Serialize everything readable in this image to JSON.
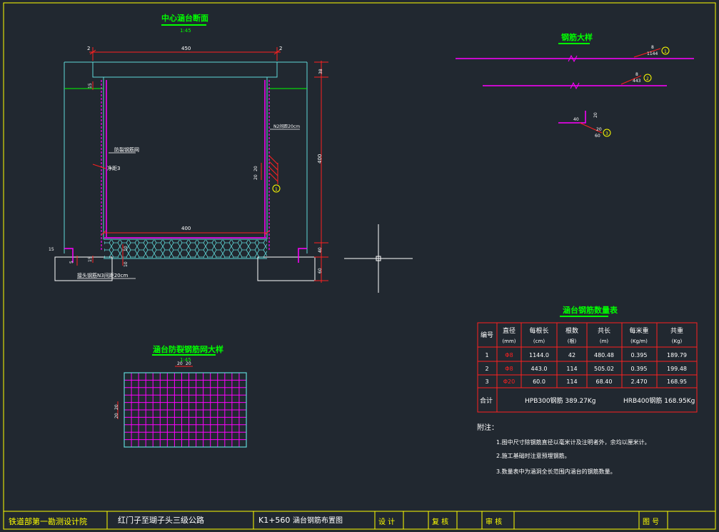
{
  "colors": {
    "background": "#212830",
    "frame": "#ffff00",
    "concrete": "#5fd7d7",
    "rebar_magenta": "#ff00ff",
    "rebar_red": "#ff2020",
    "title_green": "#00ff00",
    "dimension": "#ff2020",
    "text": "#ffffff"
  },
  "section": {
    "title": "中心涵台断面",
    "scale": "1:45",
    "dim_top_width": "450",
    "dim_left_offset": "2",
    "dim_right_offset": "2",
    "dim_top_slab": "38",
    "dim_height": "400",
    "dim_bottom_slab": "40",
    "dim_foundation": "60",
    "dim_inner_width": "400",
    "dim_15_top": "15",
    "dim_15_bottom": "15",
    "dim_10_a": "10",
    "dim_10_b": "10",
    "dim_20_a": "20",
    "dim_20_b": "20",
    "dim_20_c": "20",
    "dim_20_d": "20",
    "label_mesh": "防裂钢筋网",
    "label_gap": "净距3",
    "label_n2": "N2间距20cm",
    "label_n3": "接头钢筋N3间距20cm",
    "label_15": "15",
    "label_50": "5",
    "marker_1": "1",
    "marker_2": "2"
  },
  "detail": {
    "title": "钢筋大样",
    "bar1_len": "1144",
    "bar1_d": "8",
    "bar1_no": "1",
    "bar2_len": "443",
    "bar2_d": "8",
    "bar2_no": "2",
    "bar3_h": "40",
    "bar3_d": "20",
    "bar3_len": "60",
    "bar3_20": "20",
    "bar3_no": "3"
  },
  "mesh": {
    "title": "涵台防裂钢筋网大样",
    "scale": "1:45",
    "spacing_h1": "20",
    "spacing_h2": "20",
    "spacing_v1": "20",
    "spacing_v2": "20"
  },
  "table": {
    "title": "涵台钢筋数量表",
    "headers": [
      {
        "main": "编号",
        "unit": ""
      },
      {
        "main": "直径",
        "unit": "(mm)"
      },
      {
        "main": "每根长",
        "unit": "(cm)"
      },
      {
        "main": "根数",
        "unit": "(根)"
      },
      {
        "main": "共长",
        "unit": "(m)"
      },
      {
        "main": "每米重",
        "unit": "(Kg/m)"
      },
      {
        "main": "共重",
        "unit": "(Kg)"
      }
    ],
    "rows": [
      [
        "1",
        "Φ8",
        "1144.0",
        "42",
        "480.48",
        "0.395",
        "189.79"
      ],
      [
        "2",
        "Φ8",
        "443.0",
        "114",
        "505.02",
        "0.395",
        "199.48"
      ],
      [
        "3",
        "Φ20",
        "60.0",
        "114",
        "68.40",
        "2.470",
        "168.95"
      ]
    ],
    "total_label": "合计",
    "total_hpb": "HPB300钢筋  389.27Kg",
    "total_hrb": "HRB400钢筋  168.95Kg"
  },
  "notes": {
    "heading": "附注：",
    "items": [
      "1.图中尺寸除钢筋直径以毫米计及注明者外，余均以厘米计。",
      "2.施工基础时注意预埋钢筋。",
      "3.数量表中为涵洞全长范围内涵台的钢筋数量。"
    ]
  },
  "title_block": {
    "org": "铁道部第一勘测设计院",
    "project": "红门子至瑚子头三级公路",
    "station": "K1+560",
    "drawing": "涵台钢筋布置图",
    "design": "设  计",
    "check": "复  核",
    "review": "审  核",
    "sheet": "图  号"
  }
}
